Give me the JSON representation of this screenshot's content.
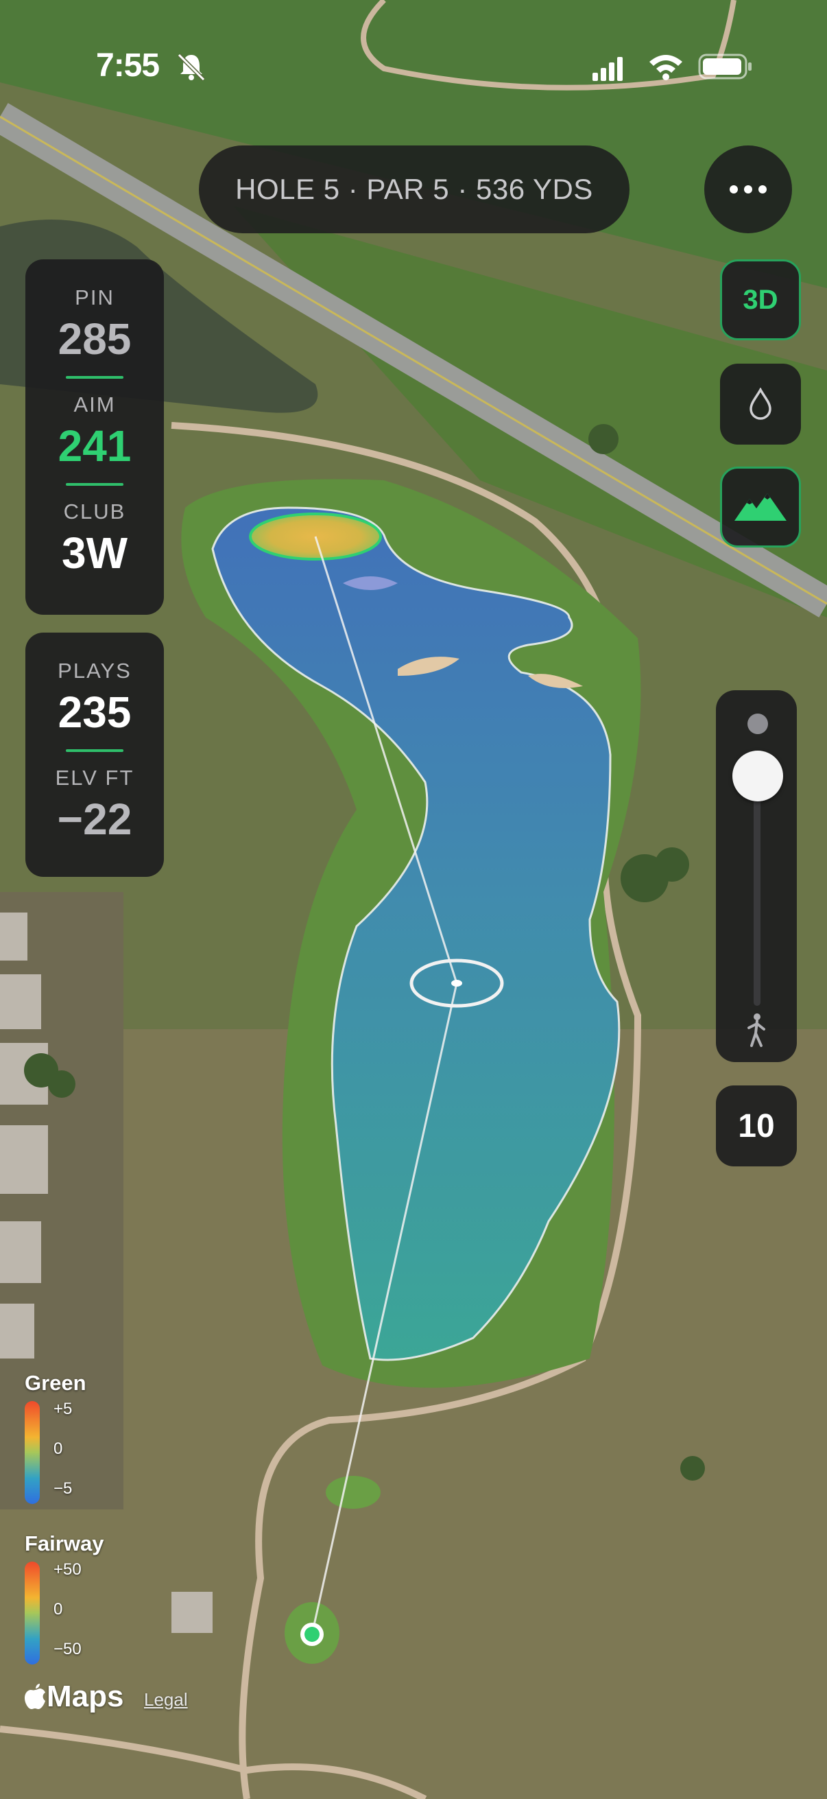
{
  "status_bar": {
    "time": "7:55"
  },
  "hole": {
    "info": "HOLE 5 · PAR 5 · 536 YDS"
  },
  "stats": {
    "pin_label": "PIN",
    "pin_value": "285",
    "aim_label": "AIM",
    "aim_value": "241",
    "club_label": "CLUB",
    "club_value": "3W"
  },
  "plays": {
    "plays_label": "PLAYS",
    "plays_value": "235",
    "elevation_label": "ELV FT",
    "elevation_value": "−22"
  },
  "controls": {
    "view_3d_label": "3D",
    "water_icon": "water-drop-icon",
    "terrain_icon": "mountains-icon"
  },
  "zoom": {
    "level": "10",
    "slider_fraction": 0.0
  },
  "legend": {
    "green": {
      "title": "Green",
      "max": "+5",
      "mid": "0",
      "min": "−5"
    },
    "fairway": {
      "title": "Fairway",
      "max": "+50",
      "mid": "0",
      "min": "−50"
    }
  },
  "attribution": {
    "brand": "Maps",
    "legal": "Legal"
  },
  "colors": {
    "accent_green": "#2fd072",
    "panel_bg": "#1c1c1e"
  }
}
